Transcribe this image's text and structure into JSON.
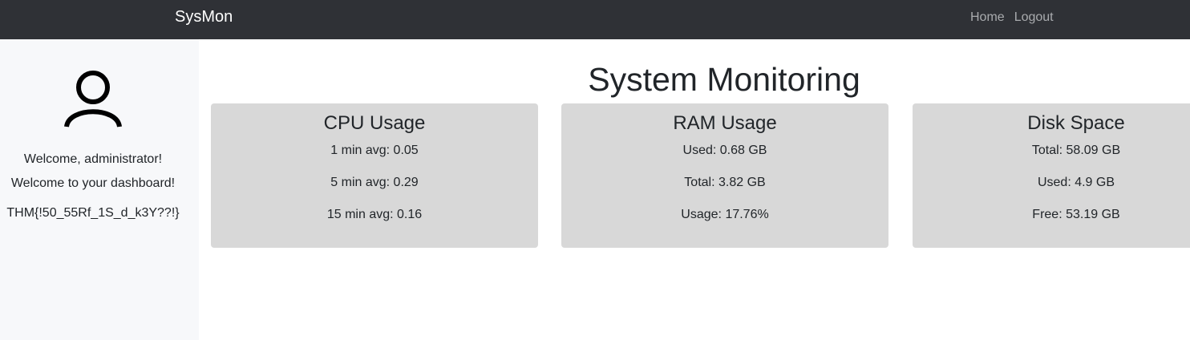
{
  "navbar": {
    "brand": "SysMon",
    "links": [
      {
        "label": "Home"
      },
      {
        "label": "Logout"
      }
    ]
  },
  "sidebar": {
    "avatar_icon": "user-icon",
    "welcome_name": "Welcome, administrator!",
    "welcome_message": "Welcome to your dashboard!",
    "flag": "THM{!50_55Rf_1S_d_k3Y??!}"
  },
  "main": {
    "title": "System Monitoring",
    "cards": [
      {
        "title": "CPU Usage",
        "lines": [
          "1 min avg: 0.05",
          "5 min avg: 0.29",
          "15 min avg: 0.16"
        ]
      },
      {
        "title": "RAM Usage",
        "lines": [
          "Used: 0.68 GB",
          "Total: 3.82 GB",
          "Usage: 17.76%"
        ]
      },
      {
        "title": "Disk Space",
        "lines": [
          "Total: 58.09 GB",
          "Used: 4.9 GB",
          "Free: 53.19 GB"
        ]
      }
    ]
  },
  "colors": {
    "navbar_bg": "#2f3136",
    "sidebar_bg": "#f7f8fa",
    "card_bg": "#d8d8d8",
    "nav_link": "#a9abae"
  }
}
